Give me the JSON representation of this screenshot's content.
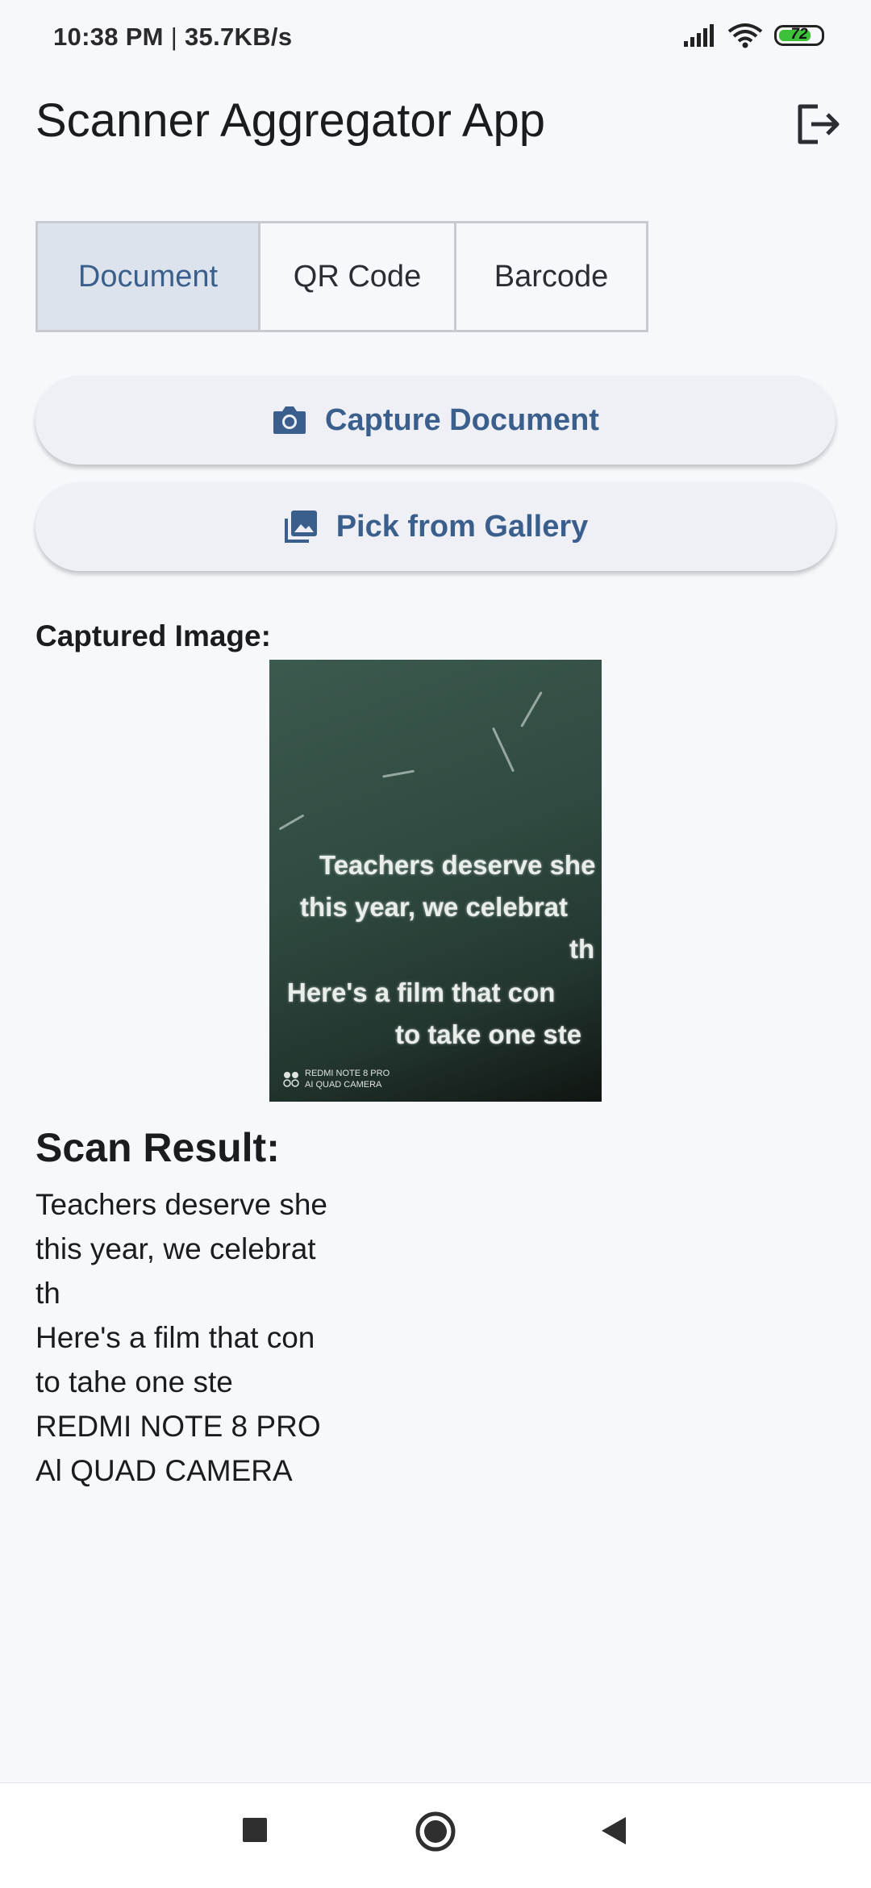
{
  "status": {
    "time": "10:38 PM",
    "speed": "35.7KB/s",
    "battery": "72"
  },
  "app": {
    "title": "Scanner Aggregator App"
  },
  "tabs": [
    {
      "label": "Document",
      "selected": true
    },
    {
      "label": "QR Code",
      "selected": false
    },
    {
      "label": "Barcode",
      "selected": false
    }
  ],
  "actions": {
    "capture_label": "Capture Document",
    "gallery_label": "Pick from Gallery"
  },
  "captured": {
    "label": "Captured Image:",
    "photo_lines": [
      "Teachers deserve she",
      "this year, we celebrat",
      "th",
      "Here's a film that con",
      "to take one ste"
    ],
    "watermark": [
      "REDMI NOTE 8 PRO",
      "AI QUAD CAMERA"
    ]
  },
  "result": {
    "title": "Scan Result:",
    "lines": [
      "Teachers deserve she",
      "this year, we celebrat",
      "th",
      "Here's a film that con",
      "to tahe one ste",
      "REDMI NOTE 8 PRO",
      "Al QUAD CAMERA"
    ]
  },
  "colors": {
    "accent": "#3b5f8c",
    "background": "#f7f8fc",
    "selected_tab": "#dde3ec"
  },
  "icons": [
    "signal-icon",
    "wifi-icon",
    "battery-icon",
    "logout-icon",
    "camera-icon",
    "gallery-icon",
    "recents-icon",
    "home-icon",
    "back-icon"
  ]
}
